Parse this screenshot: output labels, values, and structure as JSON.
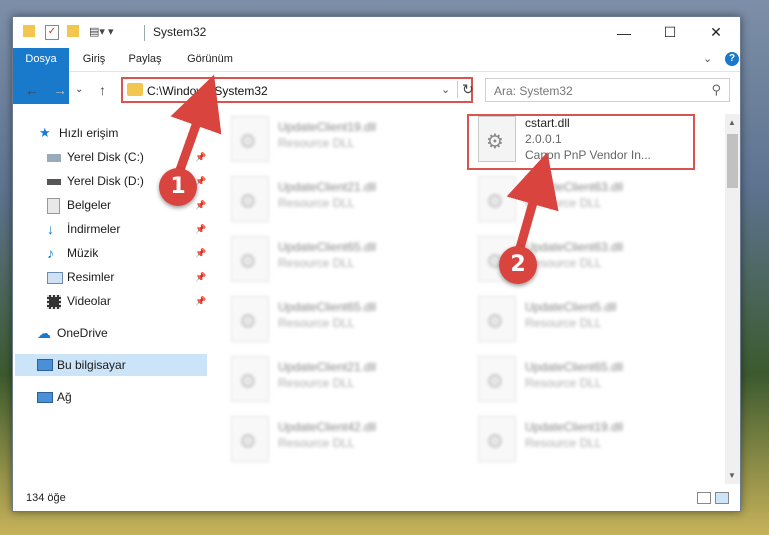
{
  "window": {
    "title": "System32",
    "minimize_glyph": "—",
    "maximize_glyph": "☐",
    "close_glyph": "✕",
    "help_glyph": "?",
    "expand_glyph": "⌄"
  },
  "ribbon": {
    "tabs": [
      "Dosya",
      "Giriş",
      "Paylaş",
      "Görünüm"
    ]
  },
  "nav": {
    "back_glyph": "←",
    "forward_glyph": "→",
    "history_glyph": "⌄",
    "up_glyph": "↑",
    "address": "C:\\Windows\\System32",
    "address_dropdown": "⌄",
    "refresh_glyph": "↻",
    "search_placeholder": "Ara: System32",
    "search_glyph": "⚲"
  },
  "sidebar": {
    "items": [
      {
        "label": "Hızlı erişim",
        "icon": "star-icon"
      },
      {
        "label": "Yerel Disk (C:)",
        "icon": "drive-icon"
      },
      {
        "label": "Yerel Disk (D:)",
        "icon": "drive-icon"
      },
      {
        "label": "Belgeler",
        "icon": "documents-icon"
      },
      {
        "label": "İndirmeler",
        "icon": "download-icon"
      },
      {
        "label": "Müzik",
        "icon": "music-icon"
      },
      {
        "label": "Resimler",
        "icon": "pictures-icon"
      },
      {
        "label": "Videolar",
        "icon": "videos-icon"
      },
      {
        "label": "OneDrive",
        "icon": "cloud-icon"
      },
      {
        "label": "Bu bilgisayar",
        "icon": "computer-icon"
      },
      {
        "label": "Ağ",
        "icon": "network-icon"
      }
    ],
    "pin_glyph": "📌",
    "selected": "Bu bilgisayar"
  },
  "files": {
    "highlighted": {
      "name": "cstart.dll",
      "version": "2.0.0.1",
      "description": "Canon PnP Vendor In..."
    },
    "left_column": [
      {
        "name": "UpdateClient19.dll",
        "description": "Resource DLL"
      },
      {
        "name": "UpdateClient21.dll",
        "description": "Resource DLL"
      },
      {
        "name": "UpdateClient65.dll",
        "description": "Resource DLL"
      },
      {
        "name": "UpdateClient65.dll",
        "description": "Resource DLL"
      },
      {
        "name": "UpdateClient21.dll",
        "description": "Resource DLL"
      },
      {
        "name": "UpdateClient42.dll",
        "description": "Resource DLL"
      }
    ],
    "right_column": [
      {
        "name": "UpdateClient63.dll",
        "description": "Resource DLL"
      },
      {
        "name": "UpdateClient63.dll",
        "description": "Resource DLL"
      },
      {
        "name": "UpdateClient5.dll",
        "description": "Resource DLL"
      },
      {
        "name": "UpdateClient65.dll",
        "description": "Resource DLL"
      },
      {
        "name": "UpdateClient19.dll",
        "description": "Resource DLL"
      }
    ]
  },
  "status": {
    "item_count": "134 öğe"
  },
  "annotations": {
    "step1": "1",
    "step2": "2",
    "color": "#d9443f"
  }
}
